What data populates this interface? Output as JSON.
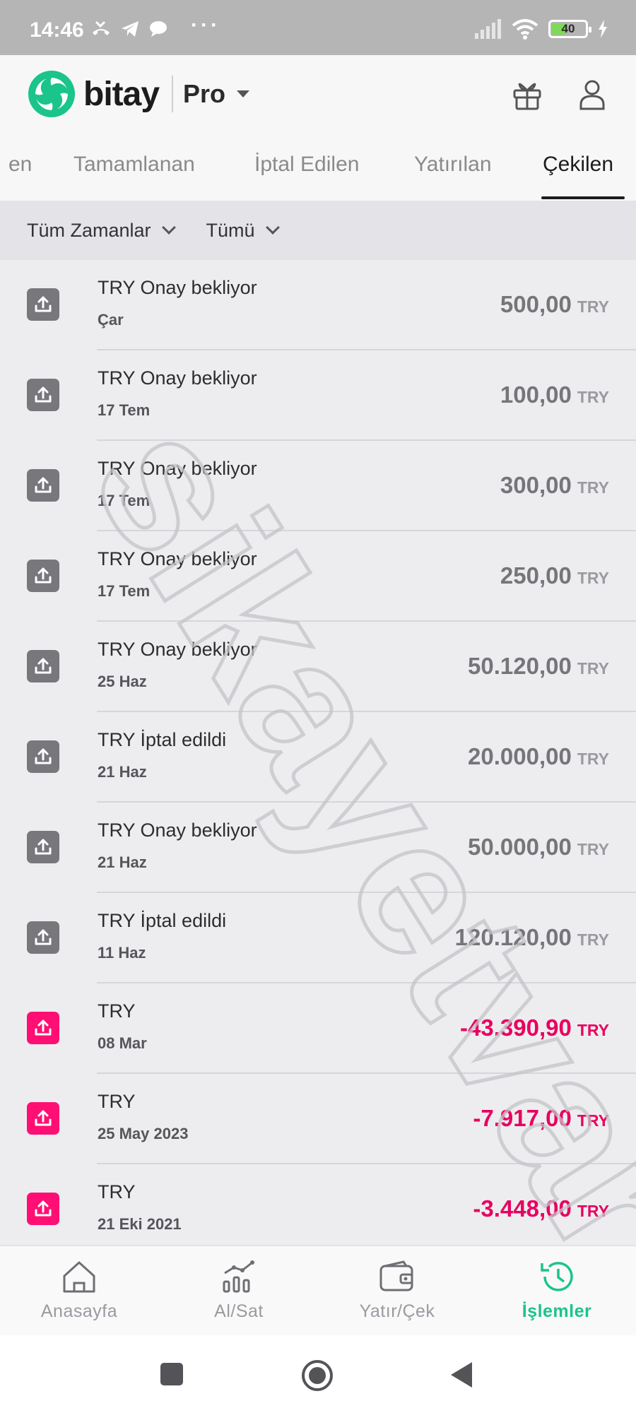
{
  "status_bar": {
    "time": "14:46",
    "battery": "40"
  },
  "header": {
    "logo_text": "bitay",
    "mode": "Pro"
  },
  "tabs": [
    {
      "label": "en"
    },
    {
      "label": "Tamamlanan"
    },
    {
      "label": "İptal Edilen"
    },
    {
      "label": "Yatırılan"
    },
    {
      "label": "Çekilen",
      "active": true
    }
  ],
  "filters": {
    "time": "Tüm Zamanlar",
    "type": "Tümü"
  },
  "transactions": [
    {
      "title": "TRY Onay bekliyor",
      "date": "Çar",
      "amount": "500,00",
      "currency": "TRY"
    },
    {
      "title": "TRY Onay bekliyor",
      "date": "17 Tem",
      "amount": "100,00",
      "currency": "TRY"
    },
    {
      "title": "TRY Onay bekliyor",
      "date": "17 Tem",
      "amount": "300,00",
      "currency": "TRY"
    },
    {
      "title": "TRY Onay bekliyor",
      "date": "17 Tem",
      "amount": "250,00",
      "currency": "TRY"
    },
    {
      "title": "TRY Onay bekliyor",
      "date": "25 Haz",
      "amount": "50.120,00",
      "currency": "TRY"
    },
    {
      "title": "TRY İptal edildi",
      "date": "21 Haz",
      "amount": "20.000,00",
      "currency": "TRY"
    },
    {
      "title": "TRY Onay bekliyor",
      "date": "21 Haz",
      "amount": "50.000,00",
      "currency": "TRY"
    },
    {
      "title": "TRY İptal edildi",
      "date": "11 Haz",
      "amount": "120.120,00",
      "currency": "TRY"
    },
    {
      "title": "TRY",
      "date": "08 Mar",
      "amount": "-43.390,90",
      "currency": "TRY"
    },
    {
      "title": "TRY",
      "date": "25 May 2023",
      "amount": "-7.917,00",
      "currency": "TRY"
    },
    {
      "title": "TRY",
      "date": "21 Eki 2021",
      "amount": "-3.448,00",
      "currency": "TRY"
    }
  ],
  "watermark": "sikayetvar",
  "bottom_nav": [
    {
      "label": "Anasayfa",
      "icon": "home-icon"
    },
    {
      "label": "Al/Sat",
      "icon": "chart-icon"
    },
    {
      "label": "Yatır/Çek",
      "icon": "wallet-icon"
    },
    {
      "label": "İşlemler",
      "icon": "history-icon",
      "active": true
    }
  ],
  "colors": {
    "brand_green": "#1bc48a",
    "negative_pink": "#e8005f",
    "icon_gray": "#77777c",
    "icon_pink": "#ff0f73"
  }
}
